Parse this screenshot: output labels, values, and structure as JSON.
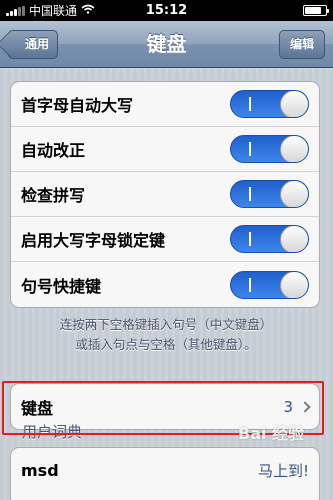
{
  "status_bar": {
    "carrier": "中国联通",
    "time": "15:12"
  },
  "nav": {
    "back_label": "通用",
    "title": "键盘",
    "edit_label": "编辑"
  },
  "settings": {
    "toggles": [
      {
        "label": "首字母自动大写",
        "state": "on",
        "on_mark": "I"
      },
      {
        "label": "自动改正",
        "state": "on",
        "on_mark": "I"
      },
      {
        "label": "检查拼写",
        "state": "on",
        "on_mark": "I"
      },
      {
        "label": "启用大写字母锁定键",
        "state": "on",
        "on_mark": "I"
      },
      {
        "label": "句号快捷键",
        "state": "on",
        "on_mark": "I"
      }
    ],
    "footer_line1": "连按两下空格键插入句号（中文键盘）",
    "footer_line2": "或插入句点与空格（其他键盘）。"
  },
  "keyboard_row": {
    "label": "键盘",
    "value": "3"
  },
  "user_dict": {
    "section_title": "用户词典",
    "first_item": "msd",
    "first_item_value": "马上到!"
  },
  "watermark": "Bai 经验",
  "colors": {
    "toggle_on": "#2f74dc",
    "highlight": "#e02020",
    "nav_bar": "#7b92af"
  }
}
